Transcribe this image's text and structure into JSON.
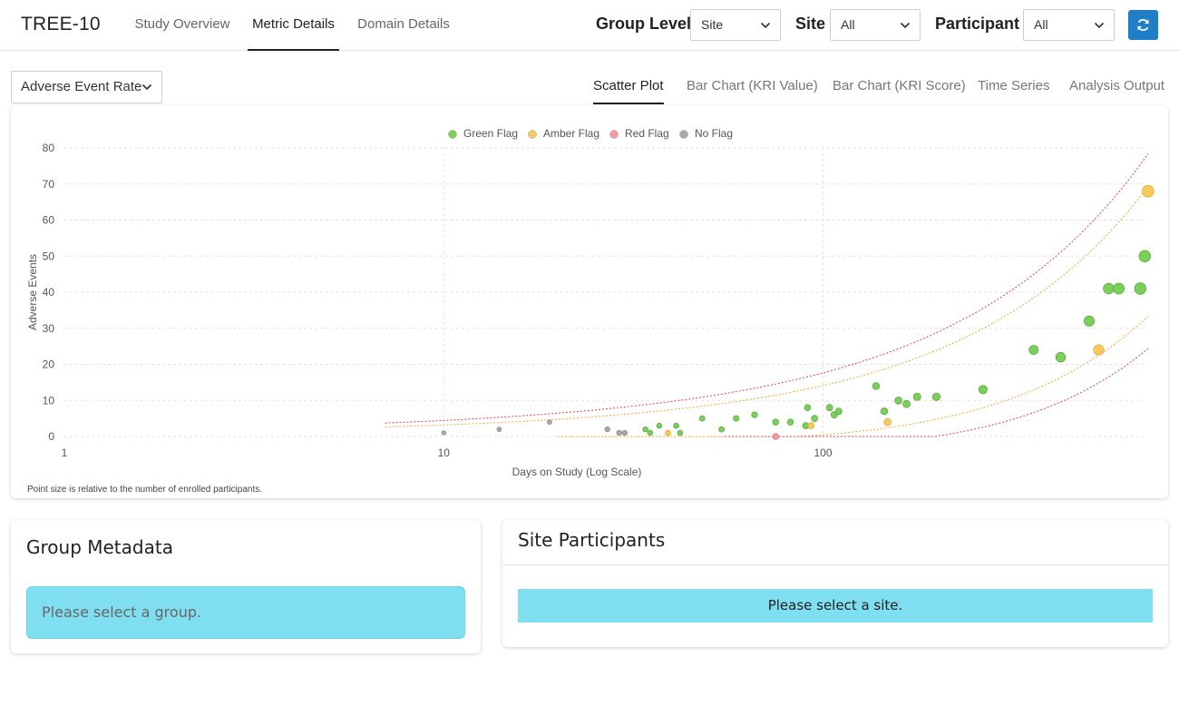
{
  "app": {
    "title": "TREE-10"
  },
  "nav": {
    "tabs": [
      {
        "label": "Study Overview",
        "active": false
      },
      {
        "label": "Metric Details",
        "active": true
      },
      {
        "label": "Domain Details",
        "active": false
      }
    ]
  },
  "filters": {
    "group_level": {
      "label": "Group Level",
      "value": "Site"
    },
    "site": {
      "label": "Site",
      "value": "All"
    },
    "participant": {
      "label": "Participant",
      "value": "All"
    },
    "refresh_icon": "refresh-icon"
  },
  "metric": {
    "selected": "Adverse Event Rate"
  },
  "view_tabs": [
    {
      "label": "Scatter Plot",
      "active": true
    },
    {
      "label": "Bar Chart (KRI Value)",
      "active": false
    },
    {
      "label": "Bar Chart (KRI Score)",
      "active": false
    },
    {
      "label": "Time Series",
      "active": false
    },
    {
      "label": "Analysis Output",
      "active": false
    }
  ],
  "chart_note": "Point size is relative to the number of enrolled participants.",
  "chart_data": {
    "type": "scatter",
    "xlabel": "Days on Study (Log Scale)",
    "ylabel": "Adverse Events",
    "x_scale": "log",
    "xlim": [
      1,
      700
    ],
    "ylim": [
      0,
      80
    ],
    "x_ticks": [
      1,
      10,
      100
    ],
    "y_ticks": [
      0,
      10,
      20,
      30,
      40,
      50,
      60,
      70,
      80
    ],
    "grid": true,
    "legend_position": "top-center",
    "colors": {
      "green": "#7cd05a",
      "amber": "#f7c95c",
      "red": "#f59aa0",
      "none": "#aaaaaa",
      "red_line": "#e0454f",
      "amber_line": "#f0a830"
    },
    "series": [
      {
        "name": "Green Flag",
        "color_key": "green",
        "points": [
          {
            "x": 34,
            "y": 2
          },
          {
            "x": 35,
            "y": 1
          },
          {
            "x": 37,
            "y": 3
          },
          {
            "x": 41,
            "y": 3
          },
          {
            "x": 42,
            "y": 1
          },
          {
            "x": 48,
            "y": 5
          },
          {
            "x": 54,
            "y": 2
          },
          {
            "x": 59,
            "y": 5
          },
          {
            "x": 66,
            "y": 6
          },
          {
            "x": 75,
            "y": 4
          },
          {
            "x": 82,
            "y": 4
          },
          {
            "x": 90,
            "y": 3
          },
          {
            "x": 91,
            "y": 8
          },
          {
            "x": 95,
            "y": 5
          },
          {
            "x": 104,
            "y": 8
          },
          {
            "x": 107,
            "y": 6
          },
          {
            "x": 110,
            "y": 7
          },
          {
            "x": 138,
            "y": 14
          },
          {
            "x": 145,
            "y": 7
          },
          {
            "x": 158,
            "y": 10
          },
          {
            "x": 166,
            "y": 9
          },
          {
            "x": 177,
            "y": 11
          },
          {
            "x": 199,
            "y": 11
          },
          {
            "x": 264,
            "y": 13
          },
          {
            "x": 359,
            "y": 24
          },
          {
            "x": 423,
            "y": 22
          },
          {
            "x": 503,
            "y": 32
          },
          {
            "x": 566,
            "y": 41
          },
          {
            "x": 602,
            "y": 41
          },
          {
            "x": 686,
            "y": 41
          },
          {
            "x": 705,
            "y": 50
          }
        ]
      },
      {
        "name": "Amber Flag",
        "color_key": "amber",
        "points": [
          {
            "x": 39,
            "y": 1
          },
          {
            "x": 93,
            "y": 3
          },
          {
            "x": 148,
            "y": 4
          },
          {
            "x": 533,
            "y": 24
          },
          {
            "x": 719,
            "y": 68
          }
        ]
      },
      {
        "name": "Red Flag",
        "color_key": "red",
        "points": [
          {
            "x": 75,
            "y": 0
          }
        ]
      },
      {
        "name": "No Flag",
        "color_key": "none",
        "points": [
          {
            "x": 10,
            "y": 1
          },
          {
            "x": 14,
            "y": 2
          },
          {
            "x": 19,
            "y": 4
          },
          {
            "x": 27,
            "y": 2
          },
          {
            "x": 29,
            "y": 1
          },
          {
            "x": 30,
            "y": 1
          }
        ]
      }
    ]
  },
  "group_metadata": {
    "title": "Group Metadata",
    "message": "Please select a group."
  },
  "site_participants": {
    "title": "Site Participants",
    "message": "Please select a site."
  }
}
